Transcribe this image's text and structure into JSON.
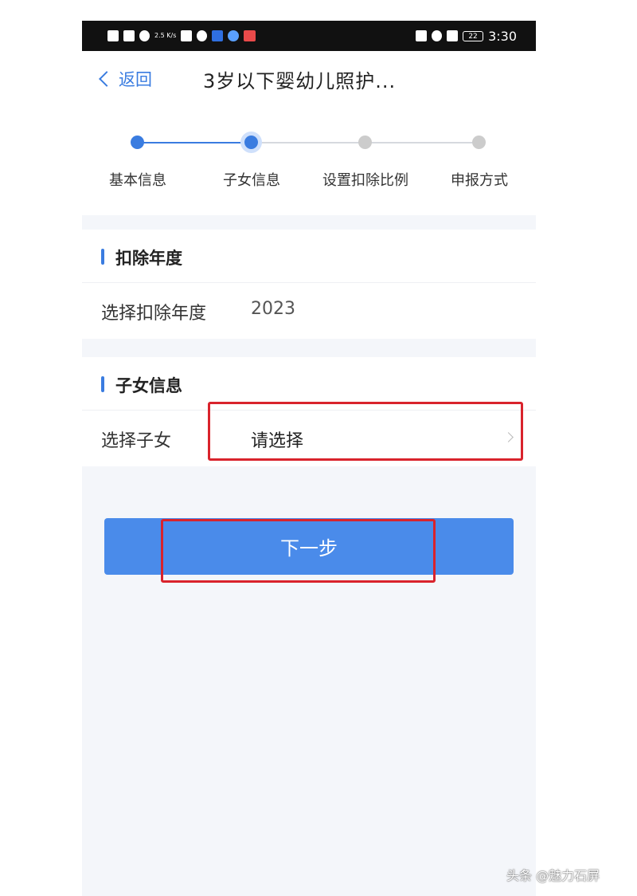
{
  "status_bar": {
    "speed": "2.5 K/s",
    "time": "3:30",
    "battery": "22",
    "icons": [
      "sim-icon",
      "signal-icon",
      "wifi-icon",
      "app-notification-icon",
      "nfc-icon",
      "alarm-icon",
      "mute-icon",
      "battery-icon"
    ]
  },
  "nav": {
    "back_label": "返回",
    "title": "3岁以下婴幼儿照护..."
  },
  "stepper": {
    "steps": [
      {
        "label": "基本信息",
        "state": "done"
      },
      {
        "label": "子女信息",
        "state": "current"
      },
      {
        "label": "设置扣除比例",
        "state": "pending"
      },
      {
        "label": "申报方式",
        "state": "pending"
      }
    ]
  },
  "deduction_year": {
    "section_title": "扣除年度",
    "row_label": "选择扣除年度",
    "value": "2023"
  },
  "child_info": {
    "section_title": "子女信息",
    "row_label": "选择子女",
    "placeholder": "请选择"
  },
  "next_button": {
    "label": "下一步"
  },
  "watermark": "头条 @魅力石屏",
  "colors": {
    "accent": "#3a7ce0",
    "button": "#4a8bea",
    "highlight_frame": "#d9232c"
  }
}
